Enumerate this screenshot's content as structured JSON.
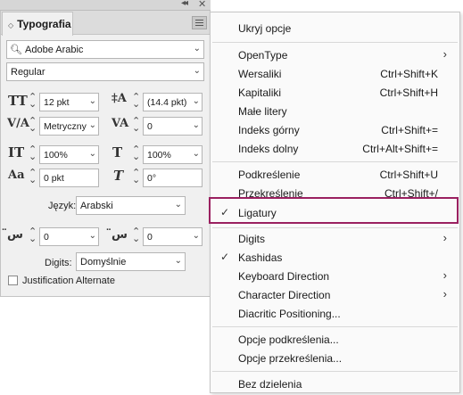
{
  "panel": {
    "tab_label": "Typografia",
    "font_family": "Adobe Arabic",
    "font_style": "Regular",
    "size": "12 pkt",
    "leading": "(14.4 pkt)",
    "kerning": "Metryczny",
    "tracking": "0",
    "vertical_scale": "100%",
    "horizontal_scale": "100%",
    "baseline_shift": "0 pkt",
    "skew": "0°",
    "language_label": "Język:",
    "language": "Arabski",
    "diacritic_x": "0",
    "diacritic_y": "0",
    "digits_label": "Digits:",
    "digits": "Domyślnie",
    "justification_label": "Justification Alternate",
    "justification_checked": false
  },
  "menu": {
    "items": [
      {
        "label": "Ukryj opcje"
      },
      {
        "label": "OpenType",
        "submenu": true
      },
      {
        "label": "Wersaliki",
        "shortcut": "Ctrl+Shift+K"
      },
      {
        "label": "Kapitaliki",
        "shortcut": "Ctrl+Shift+H"
      },
      {
        "label": "Małe litery"
      },
      {
        "label": "Indeks górny",
        "shortcut": "Ctrl+Shift+="
      },
      {
        "label": "Indeks dolny",
        "shortcut": "Ctrl+Alt+Shift+="
      },
      {
        "label": "Podkreślenie",
        "shortcut": "Ctrl+Shift+U"
      },
      {
        "label": "Przekreślenie",
        "shortcut": "Ctrl+Shift+/"
      },
      {
        "label": "Ligatury",
        "checked": true,
        "highlighted": true
      },
      {
        "label": "Digits",
        "submenu": true
      },
      {
        "label": "Kashidas",
        "checked": true
      },
      {
        "label": "Keyboard Direction",
        "submenu": true
      },
      {
        "label": "Character Direction",
        "submenu": true
      },
      {
        "label": "Diacritic Positioning..."
      },
      {
        "label": "Opcje podkreślenia..."
      },
      {
        "label": "Opcje przekreślenia..."
      },
      {
        "label": "Bez dzielenia"
      }
    ],
    "highlight_color": "#9a2060"
  }
}
